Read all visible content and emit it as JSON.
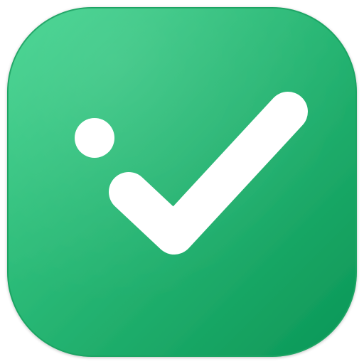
{
  "icon": {
    "name": "checkmark-app-icon",
    "glyph": "check-icon",
    "colors": {
      "gradient_start": "#43d48f",
      "gradient_end": "#0a9656",
      "border": "#1ba463",
      "mark": "#ffffff"
    }
  }
}
